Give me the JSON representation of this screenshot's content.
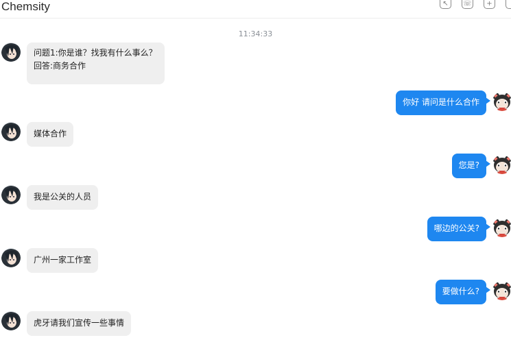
{
  "header": {
    "title": "Chemsity",
    "icons": [
      "share-icon",
      "phone-icon",
      "add-icon",
      "more-icon"
    ]
  },
  "chat": {
    "timestamp": "11:34:33",
    "messages": [
      {
        "side": "in",
        "lines": [
          "问题1:你是谁？找我有什么事么？",
          "回答:商务合作"
        ]
      },
      {
        "side": "out",
        "text": "你好 请问是什么合作"
      },
      {
        "side": "in",
        "text": "媒体合作"
      },
      {
        "side": "out",
        "text": "您是?"
      },
      {
        "side": "in",
        "text": "我是公关的人员"
      },
      {
        "side": "out",
        "text": "哪边的公关?"
      },
      {
        "side": "in",
        "text": "广州一家工作室"
      },
      {
        "side": "out",
        "text": "要做什么?"
      },
      {
        "side": "in",
        "text": "虎牙请我们宣传一些事情"
      }
    ]
  },
  "colors": {
    "outgoing_bubble": "#1e87f0",
    "incoming_bubble": "#efefef"
  }
}
